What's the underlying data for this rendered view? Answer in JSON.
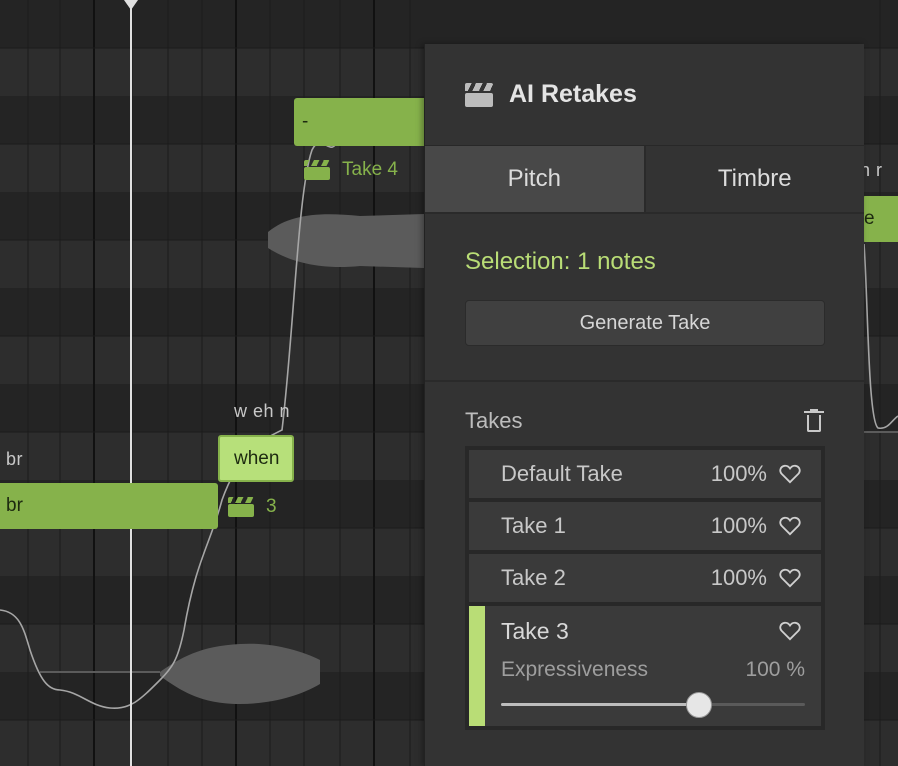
{
  "panel": {
    "title": "AI Retakes",
    "tabs": [
      {
        "label": "Pitch",
        "active": true
      },
      {
        "label": "Timbre",
        "active": false
      }
    ],
    "selection_text": "Selection: 1 notes",
    "generate_label": "Generate Take",
    "takes_label": "Takes",
    "takes": [
      {
        "name": "Default Take",
        "percent": "100%"
      },
      {
        "name": "Take 1",
        "percent": "100%"
      },
      {
        "name": "Take 2",
        "percent": "100%"
      }
    ],
    "active_take": {
      "name": "Take 3",
      "param_label": "Expressiveness",
      "param_value": "100 %",
      "slider_fraction": 0.65
    }
  },
  "roll": {
    "notes": [
      {
        "lyric": "-"
      },
      {
        "lyric": "when"
      },
      {
        "lyric": "br"
      },
      {
        "lyric": "e"
      }
    ],
    "phonemes": [
      {
        "text": "w eh n"
      },
      {
        "text": "br"
      },
      {
        "text": "n r"
      }
    ],
    "take_tags": [
      {
        "label": "Take 4"
      },
      {
        "label": "3"
      }
    ]
  },
  "colors": {
    "accent": "#b9dd76",
    "note": "#86b24b",
    "panel": "#333333",
    "background": "#262626"
  }
}
